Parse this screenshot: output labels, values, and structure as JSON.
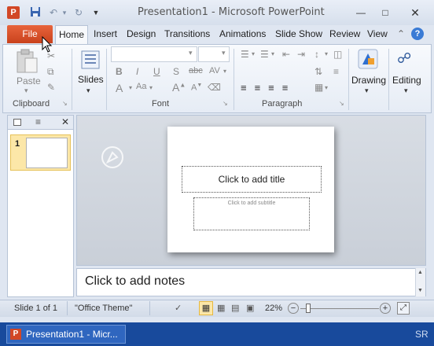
{
  "app": {
    "window_title": "Presentation1  -  Microsoft PowerPoint",
    "logo_letter": "P"
  },
  "colors": {
    "file_tab": "#d24726",
    "accent": "#2b579a",
    "thumb_selected": "#fce7a8",
    "taskbar": "#184a9c"
  },
  "ribbon_tabs": {
    "file": "File",
    "home": "Home",
    "insert": "Insert",
    "design": "Design",
    "transitions": "Transitions",
    "animations": "Animations",
    "slideshow": "Slide Show",
    "review": "Review",
    "view": "View"
  },
  "ribbon": {
    "clipboard": {
      "paste_label": "Paste",
      "group_label": "Clipboard"
    },
    "slides": {
      "slides_label": "Slides"
    },
    "font": {
      "group_label": "Font"
    },
    "paragraph": {
      "group_label": "Paragraph"
    },
    "drawing": {
      "label": "Drawing"
    },
    "editing": {
      "label": "Editing"
    }
  },
  "thumbnails": [
    {
      "number": "1"
    }
  ],
  "slide": {
    "title_placeholder": "Click to add title",
    "subtitle_placeholder": "Click to add subtitle"
  },
  "notes": {
    "placeholder": "Click to add notes"
  },
  "status": {
    "slide_info": "Slide 1 of 1",
    "theme": "\"Office Theme\"",
    "zoom": "22%"
  },
  "taskbar": {
    "task_label": "Presentation1 - Micr...",
    "lang": "SR"
  }
}
